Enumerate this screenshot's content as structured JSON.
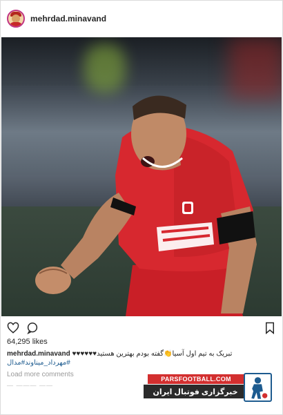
{
  "post": {
    "username": "mehrdad.minavand",
    "likes": "64,295 likes",
    "caption_user": "mehrdad.minavand",
    "caption_text": "تبریک به تیم اول آسیا👏گفته بودم بهترین هستید♥♥♥♥♥♥",
    "hashtags": "#مهرداد_میناوند#مدال",
    "load_more": "Load more comments",
    "partial_line": "— ——— ——"
  },
  "icons": {
    "like": "heart-icon",
    "comment": "comment-icon",
    "save": "bookmark-icon"
  },
  "watermark": {
    "site": "PARSFOOTBALL.COM",
    "tagline": "خبرگزاری فوتبال ایران",
    "accent": "#d32f2f"
  },
  "colors": {
    "jersey": "#d7282f",
    "link": "#1d5b8f",
    "muted": "#999999"
  }
}
